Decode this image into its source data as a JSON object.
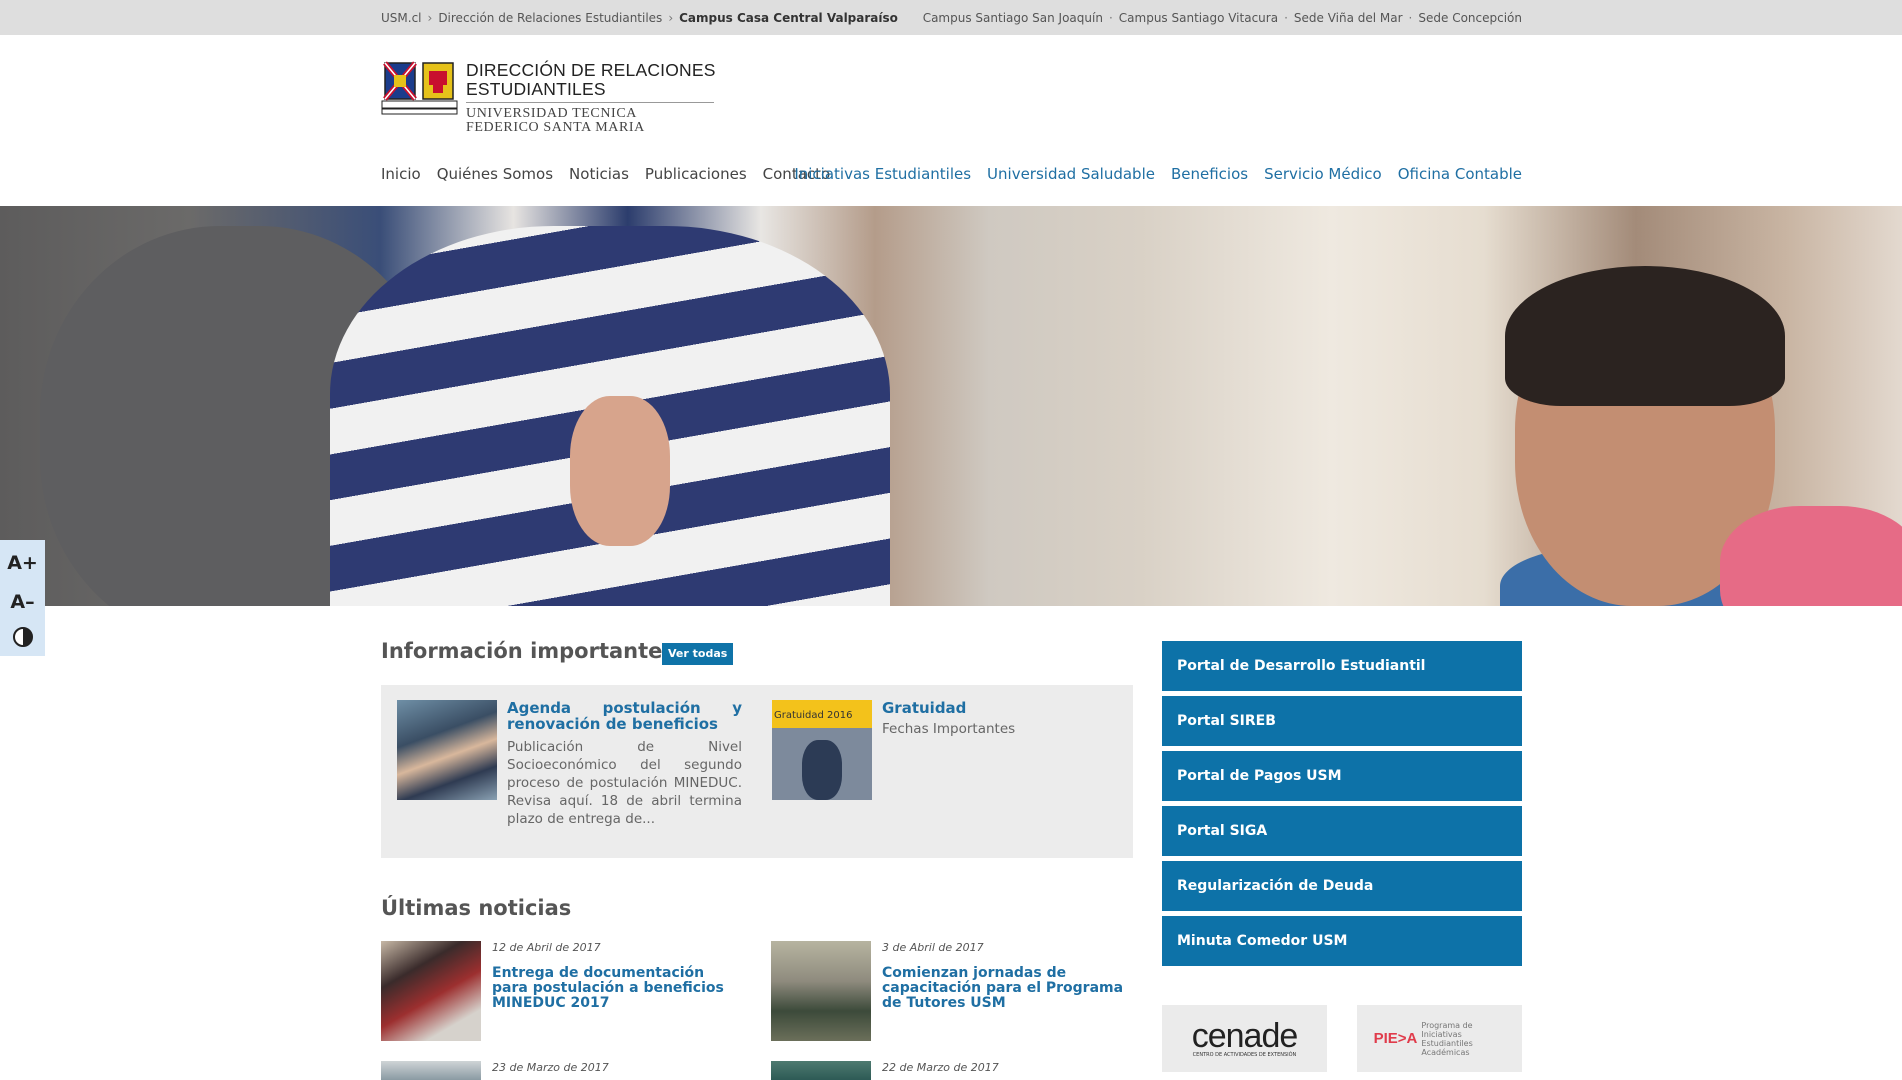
{
  "topbar": {
    "breadcrumbs": [
      "USM.cl",
      "Dirección de Relaciones Estudiantiles",
      "Campus Casa Central Valparaíso"
    ],
    "separators": [
      "›",
      "›"
    ],
    "campuses": [
      "Campus Santiago San Joaquín",
      "Campus Santiago Vitacura",
      "Sede Viña del Mar",
      "Sede Concepción"
    ],
    "campus_separator": "·"
  },
  "header": {
    "logo_title_line1": "DIRECCIÓN DE RELACIONES",
    "logo_title_line2": "ESTUDIANTILES",
    "logo_sub_line1": "UNIVERSIDAD TECNICA",
    "logo_sub_line2": "FEDERICO SANTA MARIA",
    "main_nav": [
      "Inicio",
      "Quiénes Somos",
      "Noticias",
      "Publicaciones",
      "Contacto"
    ],
    "sub_nav": [
      "Iniciativas Estudiantiles",
      "Universidad Saludable",
      "Beneficios",
      "Servicio Médico",
      "Oficina Contable"
    ]
  },
  "accessibility": {
    "increase": "A+",
    "decrease": "A–"
  },
  "info": {
    "title": "Información importante",
    "see_all": "Ver todas",
    "items": [
      {
        "title": "Agenda postulación y renovación de beneficios",
        "desc": "Publicación de Nivel Socioeconómico del segundo proceso de postulación MINEDUC. Revisa aquí. 18 de abril termina plazo de entrega de..."
      },
      {
        "title": "Gratuidad",
        "desc": "Fechas Importantes",
        "thumb_label": "Gratuidad 2016"
      }
    ]
  },
  "news": {
    "title": "Últimas noticias",
    "items": [
      {
        "date": "12 de Abril de 2017",
        "title": "Entrega de documentación para postulación a beneficios MINEDUC 2017"
      },
      {
        "date": "3 de Abril de 2017",
        "title": "Comienzan jornadas de capacitación para el Programa de Tutores USM"
      },
      {
        "date": "23 de Marzo de 2017",
        "title": ""
      },
      {
        "date": "22 de Marzo de 2017",
        "title": ""
      }
    ]
  },
  "portals": [
    "Portal de Desarrollo Estudiantil",
    "Portal SIREB",
    "Portal de Pagos USM",
    "Portal SIGA",
    "Regularización de Deuda",
    "Minuta Comedor USM"
  ],
  "partner_logos": {
    "cenade": "cenade",
    "cenade_sub": "CENTRO DE ACTIVIDADES DE EXTENSIÓN",
    "piea_short": "PIE>A",
    "piea": "Programa de Iniciativas Estudiantiles Académicas"
  },
  "colors": {
    "accent_blue": "#0d72a8",
    "link_blue": "#1f6fa3",
    "topbar_bg": "#dedede"
  }
}
